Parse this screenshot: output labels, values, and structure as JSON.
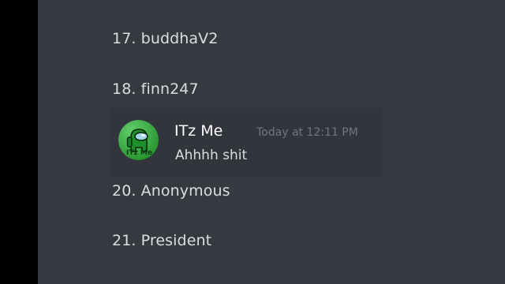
{
  "list": [
    {
      "text": "17. buddhaV2"
    },
    {
      "text": "18. finn247"
    },
    {
      "text": "20. Anonymous"
    },
    {
      "text": "21. President"
    }
  ],
  "message": {
    "author": "ITz Me",
    "timestamp": "Today at 12:11 PM",
    "text": "Ahhhh shit",
    "avatar_icon": "among-us-crewmate-avatar",
    "avatar_text": "ITz Me"
  },
  "colors": {
    "background": "#36393f",
    "message_highlight": "#32353b",
    "author": "#ffffff",
    "timestamp": "#72767d",
    "text": "#dcddde",
    "avatar_bg": "#2fbf3a"
  }
}
